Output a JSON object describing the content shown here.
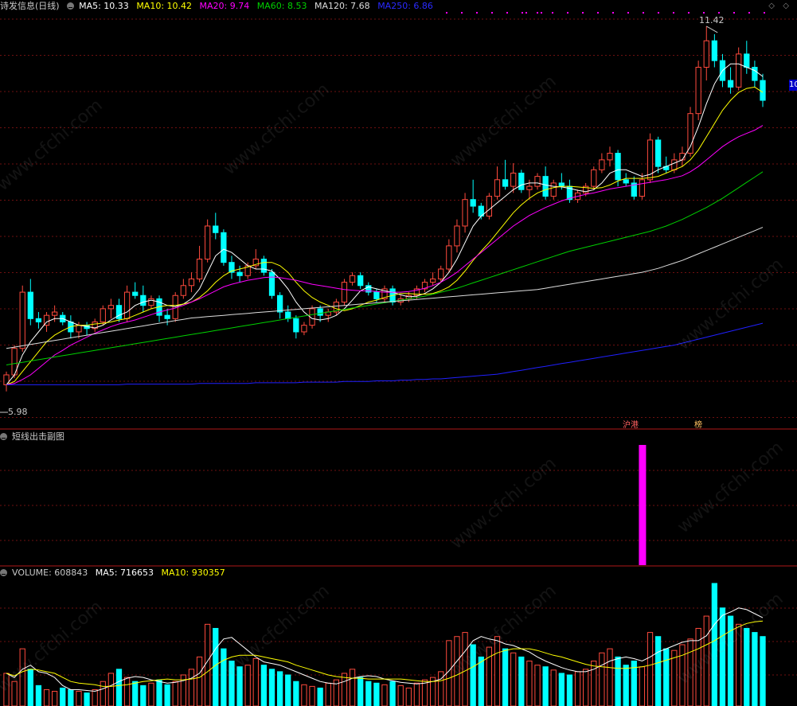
{
  "main_legend": {
    "title": "诗发信息(日线)",
    "ma5": "MA5: 10.33",
    "ma10": "MA10: 10.42",
    "ma20": "MA20: 9.74",
    "ma60": "MA60: 8.53",
    "ma120": "MA120: 7.68",
    "ma250": "MA250: 6.86"
  },
  "colors": {
    "up": "#ff4a3d",
    "down": "#00ffff",
    "ma5": "#ffffff",
    "ma10": "#ffff00",
    "ma20": "#ff00ff",
    "ma60": "#00d000",
    "ma120": "#dddddd",
    "ma250": "#2020ff",
    "signal": "#ff00ff",
    "grid": "#6e1010"
  },
  "high_label": "11.42",
  "low_label": "5.98",
  "right_edge_label": "10",
  "tags": [
    "沪港",
    "榜"
  ],
  "sub_panel": {
    "title": "短线出击副图"
  },
  "volume_legend": {
    "title": "VOLUME: 608843",
    "ma5": "MA5: 716653",
    "ma10": "MA10: 930357"
  },
  "watermark": "www.cfchi.com",
  "chart_data": {
    "type": "candlestick",
    "price_range": [
      5.5,
      11.6
    ],
    "candles": [
      [
        6.0,
        6.2,
        5.9,
        6.15
      ],
      [
        6.15,
        6.6,
        6.1,
        6.55
      ],
      [
        6.55,
        7.5,
        6.5,
        7.4
      ],
      [
        7.4,
        7.6,
        6.9,
        7.0
      ],
      [
        7.0,
        7.1,
        6.85,
        6.95
      ],
      [
        6.9,
        7.1,
        6.8,
        7.05
      ],
      [
        7.05,
        7.2,
        6.95,
        7.1
      ],
      [
        7.05,
        7.1,
        6.9,
        6.95
      ],
      [
        6.95,
        7.05,
        6.7,
        6.8
      ],
      [
        6.8,
        6.95,
        6.7,
        6.9
      ],
      [
        6.9,
        6.95,
        6.75,
        6.85
      ],
      [
        6.85,
        7.0,
        6.8,
        6.95
      ],
      [
        6.95,
        7.2,
        6.9,
        7.15
      ],
      [
        7.15,
        7.3,
        7.0,
        7.2
      ],
      [
        7.2,
        7.3,
        6.95,
        7.0
      ],
      [
        7.0,
        7.5,
        6.95,
        7.4
      ],
      [
        7.4,
        7.55,
        7.3,
        7.35
      ],
      [
        7.35,
        7.5,
        7.1,
        7.2
      ],
      [
        7.2,
        7.35,
        7.15,
        7.3
      ],
      [
        7.3,
        7.35,
        6.95,
        7.05
      ],
      [
        7.05,
        7.15,
        6.9,
        7.0
      ],
      [
        7.0,
        7.4,
        6.95,
        7.35
      ],
      [
        7.35,
        7.6,
        7.3,
        7.5
      ],
      [
        7.5,
        7.7,
        7.4,
        7.6
      ],
      [
        7.6,
        8.1,
        7.55,
        7.9
      ],
      [
        7.9,
        8.5,
        7.85,
        8.4
      ],
      [
        8.4,
        8.6,
        8.2,
        8.3
      ],
      [
        8.3,
        8.35,
        7.8,
        7.85
      ],
      [
        7.85,
        7.95,
        7.6,
        7.7
      ],
      [
        7.7,
        7.8,
        7.55,
        7.65
      ],
      [
        7.65,
        7.85,
        7.6,
        7.8
      ],
      [
        7.8,
        8.05,
        7.75,
        7.9
      ],
      [
        7.9,
        7.95,
        7.65,
        7.7
      ],
      [
        7.7,
        7.75,
        7.3,
        7.35
      ],
      [
        7.35,
        7.4,
        7.0,
        7.1
      ],
      [
        7.1,
        7.2,
        6.95,
        7.0
      ],
      [
        7.0,
        7.05,
        6.7,
        6.8
      ],
      [
        6.8,
        6.95,
        6.75,
        6.9
      ],
      [
        6.9,
        7.2,
        6.85,
        7.15
      ],
      [
        7.15,
        7.2,
        6.95,
        7.05
      ],
      [
        7.05,
        7.15,
        6.95,
        7.1
      ],
      [
        7.1,
        7.3,
        7.05,
        7.25
      ],
      [
        7.25,
        7.6,
        7.2,
        7.55
      ],
      [
        7.55,
        7.7,
        7.5,
        7.65
      ],
      [
        7.65,
        7.7,
        7.45,
        7.5
      ],
      [
        7.5,
        7.55,
        7.35,
        7.4
      ],
      [
        7.4,
        7.45,
        7.25,
        7.3
      ],
      [
        7.3,
        7.5,
        7.25,
        7.45
      ],
      [
        7.45,
        7.5,
        7.2,
        7.25
      ],
      [
        7.25,
        7.35,
        7.2,
        7.3
      ],
      [
        7.3,
        7.4,
        7.25,
        7.35
      ],
      [
        7.35,
        7.5,
        7.3,
        7.45
      ],
      [
        7.45,
        7.6,
        7.4,
        7.55
      ],
      [
        7.55,
        7.7,
        7.5,
        7.6
      ],
      [
        7.6,
        7.8,
        7.55,
        7.75
      ],
      [
        7.75,
        8.2,
        7.7,
        8.1
      ],
      [
        8.1,
        8.5,
        8.0,
        8.4
      ],
      [
        8.4,
        8.9,
        8.3,
        8.8
      ],
      [
        8.8,
        9.1,
        8.6,
        8.7
      ],
      [
        8.7,
        8.75,
        8.5,
        8.55
      ],
      [
        8.55,
        8.9,
        8.5,
        8.85
      ],
      [
        8.85,
        9.3,
        8.8,
        9.1
      ],
      [
        9.1,
        9.4,
        8.95,
        9.0
      ],
      [
        9.0,
        9.35,
        8.9,
        9.2
      ],
      [
        9.2,
        9.25,
        8.9,
        8.95
      ],
      [
        8.95,
        9.1,
        8.8,
        9.0
      ],
      [
        9.0,
        9.2,
        8.95,
        9.15
      ],
      [
        9.15,
        9.3,
        8.8,
        8.85
      ],
      [
        8.85,
        9.1,
        8.8,
        9.05
      ],
      [
        9.05,
        9.2,
        8.95,
        9.0
      ],
      [
        9.0,
        9.1,
        8.75,
        8.8
      ],
      [
        8.8,
        8.95,
        8.75,
        8.9
      ],
      [
        8.9,
        9.05,
        8.85,
        9.0
      ],
      [
        9.0,
        9.3,
        8.95,
        9.25
      ],
      [
        9.25,
        9.5,
        9.2,
        9.4
      ],
      [
        9.4,
        9.6,
        9.3,
        9.5
      ],
      [
        9.5,
        9.55,
        9.0,
        9.1
      ],
      [
        9.1,
        9.2,
        9.0,
        9.05
      ],
      [
        9.05,
        9.15,
        8.8,
        8.85
      ],
      [
        8.85,
        9.2,
        8.8,
        9.1
      ],
      [
        9.1,
        9.8,
        9.05,
        9.7
      ],
      [
        9.7,
        9.75,
        9.2,
        9.3
      ],
      [
        9.3,
        9.45,
        9.2,
        9.25
      ],
      [
        9.25,
        9.5,
        9.2,
        9.4
      ],
      [
        9.4,
        9.6,
        9.3,
        9.5
      ],
      [
        9.5,
        10.2,
        9.45,
        10.1
      ],
      [
        10.1,
        10.9,
        10.0,
        10.8
      ],
      [
        10.8,
        11.42,
        10.6,
        11.2
      ],
      [
        11.2,
        11.3,
        10.8,
        10.9
      ],
      [
        10.9,
        11.0,
        10.5,
        10.6
      ],
      [
        10.6,
        10.8,
        10.4,
        10.5
      ],
      [
        10.5,
        11.1,
        10.45,
        11.0
      ],
      [
        11.0,
        11.2,
        10.7,
        10.8
      ],
      [
        10.8,
        10.9,
        10.5,
        10.6
      ],
      [
        10.6,
        10.7,
        10.2,
        10.3
      ]
    ],
    "ma_lines": {
      "ma5": [
        6.0,
        6.15,
        6.45,
        6.65,
        6.8,
        6.95,
        7.0,
        7.0,
        6.95,
        6.9,
        6.88,
        6.86,
        6.9,
        6.98,
        7.05,
        7.1,
        7.2,
        7.25,
        7.28,
        7.25,
        7.2,
        7.18,
        7.22,
        7.3,
        7.45,
        7.7,
        7.95,
        8.05,
        8.0,
        7.9,
        7.8,
        7.75,
        7.75,
        7.72,
        7.6,
        7.45,
        7.25,
        7.1,
        7.0,
        6.98,
        7.0,
        7.05,
        7.15,
        7.28,
        7.42,
        7.48,
        7.45,
        7.42,
        7.4,
        7.36,
        7.33,
        7.34,
        7.38,
        7.45,
        7.55,
        7.7,
        7.9,
        8.15,
        8.4,
        8.55,
        8.65,
        8.75,
        8.85,
        8.95,
        9.02,
        9.05,
        9.05,
        9.02,
        9.0,
        8.99,
        8.97,
        8.94,
        8.92,
        8.95,
        9.05,
        9.2,
        9.25,
        9.25,
        9.2,
        9.15,
        9.18,
        9.25,
        9.3,
        9.35,
        9.4,
        9.6,
        9.9,
        10.25,
        10.55,
        10.75,
        10.85,
        10.85,
        10.8,
        10.75,
        10.66
      ],
      "ma10": [
        6.0,
        6.05,
        6.2,
        6.35,
        6.5,
        6.65,
        6.75,
        6.82,
        6.88,
        6.9,
        6.9,
        6.92,
        6.93,
        6.95,
        6.98,
        7.0,
        7.05,
        7.1,
        7.15,
        7.18,
        7.2,
        7.2,
        7.22,
        7.25,
        7.32,
        7.42,
        7.55,
        7.65,
        7.72,
        7.75,
        7.78,
        7.82,
        7.85,
        7.85,
        7.8,
        7.7,
        7.55,
        7.42,
        7.32,
        7.25,
        7.2,
        7.15,
        7.12,
        7.15,
        7.2,
        7.25,
        7.28,
        7.32,
        7.35,
        7.38,
        7.38,
        7.37,
        7.37,
        7.38,
        7.42,
        7.48,
        7.58,
        7.72,
        7.88,
        8.02,
        8.15,
        8.3,
        8.45,
        8.6,
        8.72,
        8.82,
        8.9,
        8.95,
        8.98,
        9.0,
        9.0,
        8.99,
        8.98,
        8.97,
        8.98,
        9.02,
        9.08,
        9.12,
        9.12,
        9.12,
        9.13,
        9.15,
        9.2,
        9.25,
        9.3,
        9.4,
        9.55,
        9.75,
        9.95,
        10.15,
        10.3,
        10.42,
        10.48,
        10.5,
        10.42
      ],
      "ma20": [
        6.0,
        6.02,
        6.08,
        6.15,
        6.25,
        6.35,
        6.45,
        6.52,
        6.6,
        6.66,
        6.72,
        6.78,
        6.83,
        6.88,
        6.92,
        6.95,
        6.98,
        7.02,
        7.06,
        7.1,
        7.13,
        7.16,
        7.2,
        7.25,
        7.3,
        7.36,
        7.42,
        7.48,
        7.52,
        7.55,
        7.58,
        7.6,
        7.62,
        7.63,
        7.62,
        7.6,
        7.58,
        7.55,
        7.52,
        7.5,
        7.48,
        7.46,
        7.44,
        7.43,
        7.42,
        7.42,
        7.41,
        7.4,
        7.4,
        7.4,
        7.41,
        7.43,
        7.46,
        7.5,
        7.55,
        7.62,
        7.7,
        7.8,
        7.9,
        8.0,
        8.1,
        8.2,
        8.3,
        8.4,
        8.48,
        8.56,
        8.62,
        8.68,
        8.73,
        8.78,
        8.82,
        8.85,
        8.88,
        8.9,
        8.93,
        8.96,
        8.98,
        9.0,
        9.02,
        9.04,
        9.06,
        9.08,
        9.1,
        9.13,
        9.16,
        9.22,
        9.3,
        9.4,
        9.5,
        9.6,
        9.68,
        9.75,
        9.8,
        9.85,
        9.92
      ],
      "ma60": [
        6.3,
        6.32,
        6.34,
        6.36,
        6.38,
        6.4,
        6.42,
        6.44,
        6.46,
        6.48,
        6.5,
        6.52,
        6.54,
        6.56,
        6.58,
        6.6,
        6.62,
        6.64,
        6.66,
        6.68,
        6.7,
        6.72,
        6.74,
        6.76,
        6.78,
        6.8,
        6.82,
        6.84,
        6.86,
        6.88,
        6.9,
        6.92,
        6.94,
        6.96,
        6.98,
        7.0,
        7.02,
        7.04,
        7.06,
        7.08,
        7.1,
        7.12,
        7.14,
        7.16,
        7.18,
        7.2,
        7.22,
        7.24,
        7.26,
        7.28,
        7.3,
        7.32,
        7.34,
        7.37,
        7.4,
        7.43,
        7.46,
        7.5,
        7.54,
        7.58,
        7.62,
        7.66,
        7.7,
        7.74,
        7.78,
        7.82,
        7.86,
        7.9,
        7.94,
        7.98,
        8.02,
        8.05,
        8.08,
        8.11,
        8.14,
        8.17,
        8.2,
        8.23,
        8.26,
        8.29,
        8.32,
        8.36,
        8.4,
        8.45,
        8.5,
        8.56,
        8.62,
        8.68,
        8.75,
        8.82,
        8.9,
        8.98,
        9.06,
        9.14,
        9.22
      ],
      "ma120": [
        6.55,
        6.57,
        6.59,
        6.61,
        6.63,
        6.65,
        6.67,
        6.69,
        6.71,
        6.73,
        6.75,
        6.77,
        6.79,
        6.81,
        6.83,
        6.85,
        6.87,
        6.89,
        6.91,
        6.93,
        6.95,
        6.97,
        6.99,
        7.01,
        7.02,
        7.03,
        7.04,
        7.05,
        7.06,
        7.07,
        7.08,
        7.09,
        7.1,
        7.11,
        7.12,
        7.13,
        7.14,
        7.15,
        7.16,
        7.17,
        7.18,
        7.19,
        7.2,
        7.21,
        7.22,
        7.23,
        7.24,
        7.25,
        7.26,
        7.27,
        7.28,
        7.29,
        7.3,
        7.31,
        7.32,
        7.33,
        7.34,
        7.35,
        7.36,
        7.37,
        7.38,
        7.39,
        7.4,
        7.41,
        7.42,
        7.43,
        7.44,
        7.46,
        7.48,
        7.5,
        7.52,
        7.54,
        7.56,
        7.58,
        7.6,
        7.62,
        7.64,
        7.66,
        7.68,
        7.7,
        7.73,
        7.76,
        7.8,
        7.84,
        7.88,
        7.93,
        7.98,
        8.03,
        8.08,
        8.13,
        8.18,
        8.23,
        8.28,
        8.33,
        8.38
      ],
      "ma250": [
        6.0,
        6.0,
        6.0,
        6.0,
        6.0,
        6.0,
        6.0,
        6.0,
        6.0,
        6.0,
        6.0,
        6.0,
        6.0,
        6.0,
        6.0,
        6.01,
        6.01,
        6.01,
        6.01,
        6.01,
        6.01,
        6.01,
        6.01,
        6.01,
        6.02,
        6.02,
        6.02,
        6.02,
        6.02,
        6.02,
        6.02,
        6.03,
        6.03,
        6.03,
        6.03,
        6.03,
        6.03,
        6.04,
        6.04,
        6.04,
        6.04,
        6.04,
        6.05,
        6.05,
        6.05,
        6.05,
        6.06,
        6.06,
        6.06,
        6.07,
        6.07,
        6.08,
        6.08,
        6.09,
        6.09,
        6.1,
        6.11,
        6.12,
        6.13,
        6.14,
        6.15,
        6.16,
        6.18,
        6.2,
        6.22,
        6.24,
        6.26,
        6.28,
        6.3,
        6.32,
        6.34,
        6.36,
        6.38,
        6.4,
        6.42,
        6.44,
        6.46,
        6.48,
        6.5,
        6.52,
        6.54,
        6.56,
        6.58,
        6.6,
        6.63,
        6.66,
        6.69,
        6.72,
        6.75,
        6.78,
        6.81,
        6.84,
        6.87,
        6.9,
        6.93
      ]
    },
    "signal_bar_index": 79,
    "volume": [
      40,
      30,
      70,
      45,
      25,
      20,
      18,
      22,
      20,
      18,
      16,
      20,
      30,
      40,
      45,
      35,
      30,
      25,
      28,
      32,
      26,
      30,
      38,
      45,
      60,
      100,
      95,
      70,
      55,
      48,
      50,
      58,
      50,
      45,
      42,
      38,
      30,
      26,
      24,
      22,
      28,
      32,
      40,
      45,
      35,
      30,
      28,
      26,
      30,
      25,
      22,
      28,
      32,
      35,
      42,
      80,
      85,
      90,
      75,
      60,
      72,
      85,
      70,
      65,
      60,
      55,
      50,
      48,
      44,
      40,
      38,
      42,
      45,
      55,
      65,
      70,
      60,
      50,
      55,
      48,
      90,
      85,
      70,
      68,
      75,
      82,
      95,
      110,
      150,
      120,
      110,
      100,
      95,
      90,
      85
    ],
    "volume_ma5": [
      40,
      35,
      45,
      50,
      42,
      40,
      35,
      25,
      20,
      20,
      19,
      18,
      21,
      25,
      30,
      34,
      36,
      35,
      32,
      30,
      28,
      29,
      31,
      34,
      40,
      55,
      70,
      82,
      84,
      76,
      68,
      60,
      54,
      52,
      50,
      46,
      42,
      38,
      34,
      30,
      28,
      27,
      30,
      34,
      36,
      37,
      36,
      33,
      31,
      29,
      28,
      27,
      28,
      30,
      33,
      43,
      55,
      67,
      80,
      85,
      82,
      80,
      76,
      74,
      70,
      66,
      60,
      55,
      51,
      47,
      44,
      42,
      42,
      45,
      50,
      55,
      58,
      60,
      58,
      55,
      60,
      66,
      70,
      74,
      78,
      80,
      80,
      86,
      100,
      111,
      115,
      120,
      118,
      113,
      108
    ],
    "volume_ma10": [
      40,
      37,
      42,
      45,
      44,
      42,
      40,
      35,
      30,
      28,
      27,
      26,
      24,
      24,
      25,
      26,
      28,
      30,
      31,
      32,
      33,
      32,
      32,
      33,
      35,
      42,
      50,
      56,
      60,
      62,
      62,
      62,
      60,
      58,
      56,
      54,
      50,
      47,
      44,
      41,
      38,
      36,
      35,
      34,
      34,
      33,
      33,
      33,
      33,
      33,
      32,
      31,
      30,
      30,
      31,
      34,
      38,
      43,
      48,
      54,
      60,
      65,
      68,
      70,
      70,
      70,
      68,
      65,
      62,
      60,
      57,
      54,
      51,
      49,
      48,
      47,
      46,
      46,
      47,
      48,
      50,
      53,
      56,
      59,
      62,
      66,
      70,
      75,
      80,
      86,
      92,
      97,
      101,
      103,
      104
    ]
  }
}
